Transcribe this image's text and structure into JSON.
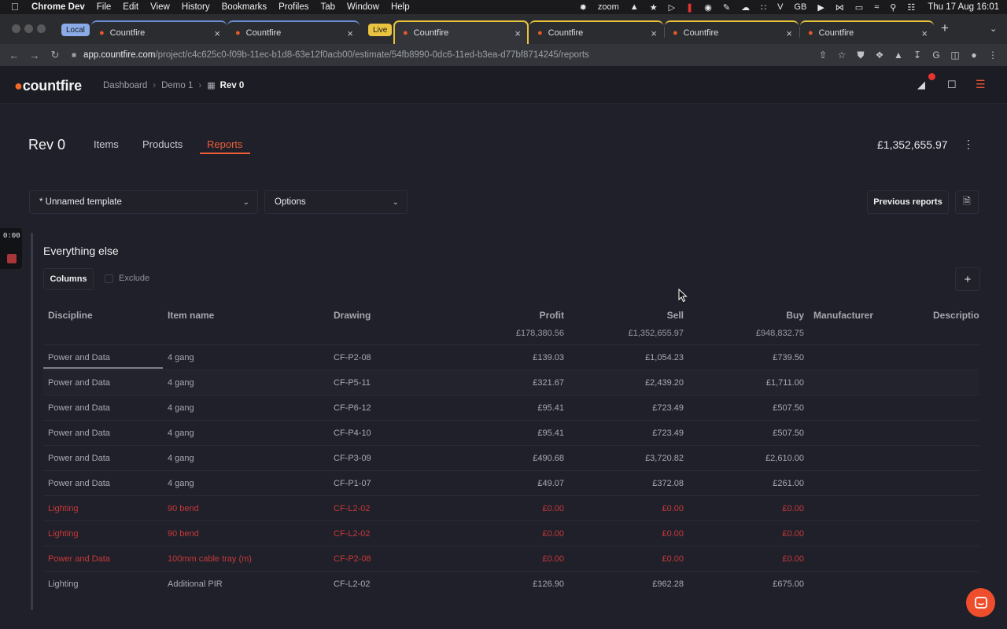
{
  "menubar": {
    "app_name": "Chrome Dev",
    "items": [
      "File",
      "Edit",
      "View",
      "History",
      "Bookmarks",
      "Profiles",
      "Tab",
      "Window",
      "Help"
    ],
    "status_icons": [
      "gear-icon",
      "zoom-text",
      "label-icon",
      "fox-icon",
      "play-icon",
      "record-icon",
      "one-password-icon",
      "pen-icon",
      "cloud-icon",
      "grid-icon",
      "v-icon",
      "keyboard-gb",
      "play-circle-icon",
      "bluetooth-icon",
      "battery-icon",
      "wifi-icon",
      "search-icon",
      "control-center-icon"
    ],
    "zoom_label": "zoom",
    "kb_label": "GB",
    "clock": "Thu 17 Aug  16:01"
  },
  "tabs": {
    "local_badge": "Local",
    "live_badge": "Live",
    "list": [
      {
        "label": "Countfire"
      },
      {
        "label": "Countfire"
      },
      {
        "label": "Countfire"
      },
      {
        "label": "Countfire"
      },
      {
        "label": "Countfire"
      },
      {
        "label": "Countfire"
      }
    ]
  },
  "address": {
    "host": "app.countfire.com",
    "path": "/project/c4c625c0-f09b-11ec-b1d8-63e12f0acb00/estimate/54fb8990-0dc6-11ed-b3ea-d77bf8714245/reports"
  },
  "header": {
    "logo": "countfire",
    "breadcrumb": [
      "Dashboard",
      "Demo 1",
      "Rev 0"
    ]
  },
  "page": {
    "title": "Rev 0",
    "tabs": [
      "Items",
      "Products",
      "Reports"
    ],
    "active_tab": "Reports",
    "total": "£1,352,655.97"
  },
  "controls": {
    "template": "* Unnamed template",
    "options": "Options",
    "previous_reports": "Previous reports"
  },
  "recorder": {
    "time": "0:00"
  },
  "section": {
    "title": "Everything else",
    "columns_button": "Columns",
    "exclude_label": "Exclude"
  },
  "table": {
    "headers": [
      "Discipline",
      "Item name",
      "Drawing",
      "Profit",
      "Sell",
      "Buy",
      "Manufacturer",
      "Descriptio"
    ],
    "totals": {
      "profit": "£178,380.56",
      "sell": "£1,352,655.97",
      "buy": "£948,832.75"
    },
    "rows": [
      {
        "discipline": "Power and Data",
        "item": "4 gang",
        "drawing": "CF-P2-08",
        "profit": "£139.03",
        "sell": "£1,054.23",
        "buy": "£739.50",
        "error": false
      },
      {
        "discipline": "Power and Data",
        "item": "4 gang",
        "drawing": "CF-P5-11",
        "profit": "£321.67",
        "sell": "£2,439.20",
        "buy": "£1,711.00",
        "error": false
      },
      {
        "discipline": "Power and Data",
        "item": "4 gang",
        "drawing": "CF-P6-12",
        "profit": "£95.41",
        "sell": "£723.49",
        "buy": "£507.50",
        "error": false
      },
      {
        "discipline": "Power and Data",
        "item": "4 gang",
        "drawing": "CF-P4-10",
        "profit": "£95.41",
        "sell": "£723.49",
        "buy": "£507.50",
        "error": false
      },
      {
        "discipline": "Power and Data",
        "item": "4 gang",
        "drawing": "CF-P3-09",
        "profit": "£490.68",
        "sell": "£3,720.82",
        "buy": "£2,610.00",
        "error": false
      },
      {
        "discipline": "Power and Data",
        "item": "4 gang",
        "drawing": "CF-P1-07",
        "profit": "£49.07",
        "sell": "£372.08",
        "buy": "£261.00",
        "error": false
      },
      {
        "discipline": "Lighting",
        "item": "90 bend",
        "drawing": "CF-L2-02",
        "profit": "£0.00",
        "sell": "£0.00",
        "buy": "£0.00",
        "error": true
      },
      {
        "discipline": "Lighting",
        "item": "90 bend",
        "drawing": "CF-L2-02",
        "profit": "£0.00",
        "sell": "£0.00",
        "buy": "£0.00",
        "error": true
      },
      {
        "discipline": "Power and Data",
        "item": "100mm cable tray (m)",
        "drawing": "CF-P2-08",
        "profit": "£0.00",
        "sell": "£0.00",
        "buy": "£0.00",
        "error": true
      },
      {
        "discipline": "Lighting",
        "item": "Additional PIR",
        "drawing": "CF-L2-02",
        "profit": "£126.90",
        "sell": "£962.28",
        "buy": "£675.00",
        "error": false
      }
    ]
  }
}
